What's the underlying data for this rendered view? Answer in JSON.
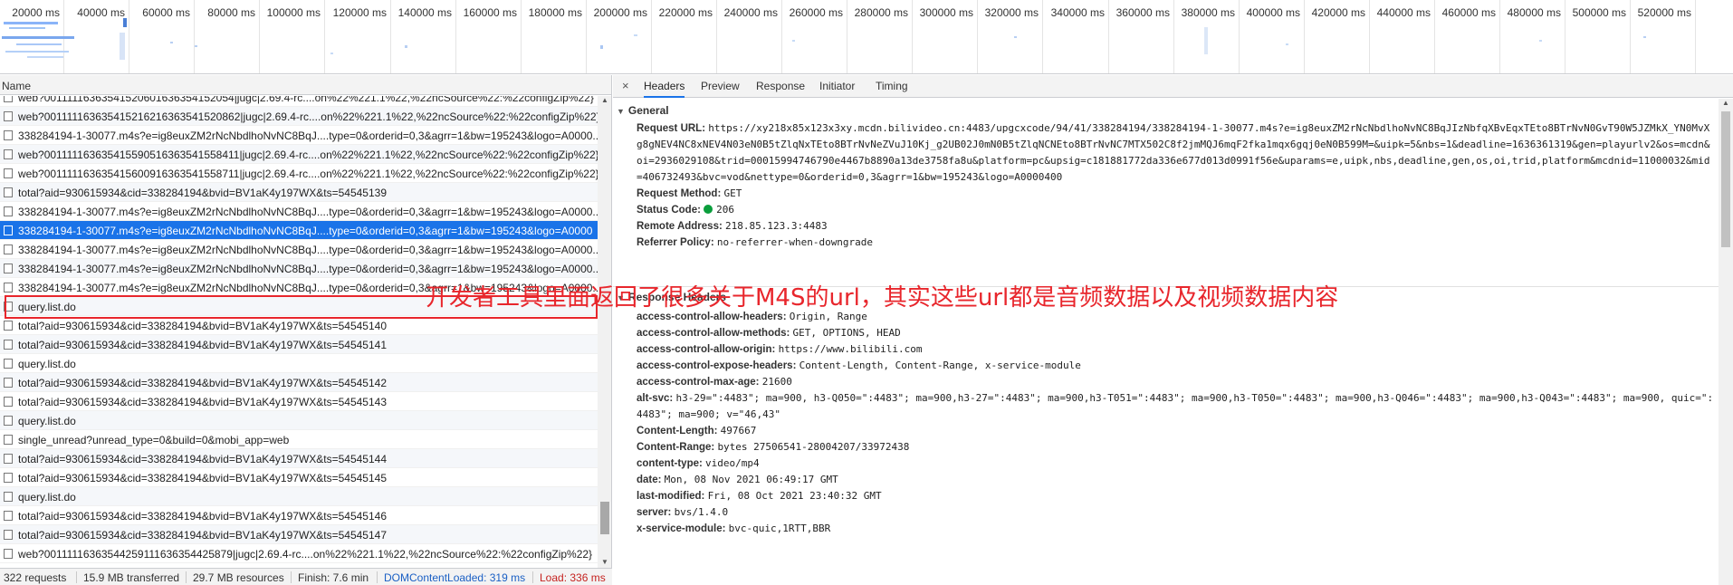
{
  "overview": {
    "ticks": [
      "20000 ms",
      "40000 ms",
      "60000 ms",
      "80000 ms",
      "100000 ms",
      "120000 ms",
      "140000 ms",
      "160000 ms",
      "180000 ms",
      "200000 ms",
      "220000 ms",
      "240000 ms",
      "260000 ms",
      "280000 ms",
      "300000 ms",
      "320000 ms",
      "340000 ms",
      "360000 ms",
      "380000 ms",
      "400000 ms",
      "420000 ms",
      "440000 ms",
      "460000 ms",
      "480000 ms",
      "500000 ms",
      "520000 ms"
    ]
  },
  "list": {
    "header": "Name",
    "rows": [
      "web?00111116363541520601636354152054|jugc|2.69.4-rc....on%22%221.1%22,%22ncSource%22:%22configZip%22}",
      "web?001111163635415216216363541520862|jugc|2.69.4-rc....on%22%221.1%22,%22ncSource%22:%22configZip%22}",
      "338284194-1-30077.m4s?e=ig8euxZM2rNcNbdlhoNvNC8BqJ....type=0&orderid=0,3&agrr=1&bw=195243&logo=A0000...",
      "web?001111163635415590516363541558411|jugc|2.69.4-rc....on%22%221.1%22,%22ncSource%22:%22configZip%22}",
      "web?001111163635415600916363541558711|jugc|2.69.4-rc....on%22%221.1%22,%22ncSource%22:%22configZip%22}",
      "total?aid=930615934&cid=338284194&bvid=BV1aK4y197WX&ts=54545139",
      "338284194-1-30077.m4s?e=ig8euxZM2rNcNbdlhoNvNC8BqJ....type=0&orderid=0,3&agrr=1&bw=195243&logo=A0000...",
      "338284194-1-30077.m4s?e=ig8euxZM2rNcNbdlhoNvNC8BqJ....type=0&orderid=0,3&agrr=1&bw=195243&logo=A0000",
      "338284194-1-30077.m4s?e=ig8euxZM2rNcNbdlhoNvNC8BqJ....type=0&orderid=0,3&agrr=1&bw=195243&logo=A0000...",
      "338284194-1-30077.m4s?e=ig8euxZM2rNcNbdlhoNvNC8BqJ....type=0&orderid=0,3&agrr=1&bw=195243&logo=A0000...",
      "338284194-1-30077.m4s?e=ig8euxZM2rNcNbdlhoNvNC8BqJ....type=0&orderid=0,3&agrr=1&bw=195243&logo=A0000...",
      "query.list.do",
      "total?aid=930615934&cid=338284194&bvid=BV1aK4y197WX&ts=54545140",
      "total?aid=930615934&cid=338284194&bvid=BV1aK4y197WX&ts=54545141",
      "query.list.do",
      "total?aid=930615934&cid=338284194&bvid=BV1aK4y197WX&ts=54545142",
      "total?aid=930615934&cid=338284194&bvid=BV1aK4y197WX&ts=54545143",
      "query.list.do",
      "single_unread?unread_type=0&build=0&mobi_app=web",
      "total?aid=930615934&cid=338284194&bvid=BV1aK4y197WX&ts=54545144",
      "total?aid=930615934&cid=338284194&bvid=BV1aK4y197WX&ts=54545145",
      "query.list.do",
      "total?aid=930615934&cid=338284194&bvid=BV1aK4y197WX&ts=54545146",
      "total?aid=930615934&cid=338284194&bvid=BV1aK4y197WX&ts=54545147",
      "web?00111116363544259111636354425879|jugc|2.69.4-rc....on%22%221.1%22,%22ncSource%22:%22configZip%22}"
    ],
    "selected_index": 7
  },
  "status": {
    "requests": "322 requests",
    "transferred": "15.9 MB transferred",
    "resources": "29.7 MB resources",
    "finish": "Finish: 7.6 min",
    "dom_loaded": "DOMContentLoaded: 319 ms",
    "load": "Load: 336 ms"
  },
  "tabs": {
    "close": "×",
    "items": [
      "Headers",
      "Preview",
      "Response",
      "Initiator",
      "Timing"
    ],
    "active": "Headers"
  },
  "general": {
    "title": "General",
    "request_url_key": "Request URL:",
    "request_url_value": "https://xy218x85x123x3xy.mcdn.bilivideo.cn:4483/upgcxcode/94/41/338284194/338284194-1-30077.m4s?e=ig8euxZM2rNcNbdlhoNvNC8BqJIzNbfqXBvEqxTEto8BTrNvN0GvT90W5JZMkX_YN0MvXg8gNEV4NC8xNEV4N03eN0B5tZlqNxTEto8BTrNvNeZVuJ10Kj_g2UB02J0mN0B5tZlqNCNEto8BTrNvNC7MTX502C8f2jmMQJ6mqF2fka1mqx6gqj0eN0B599M=&uipk=5&nbs=1&deadline=1636361319&gen=playurlv2&os=mcdn&oi=2936029108&trid=00015994746790e4467b8890a13de3758fa8u&platform=pc&upsig=c181881772da336e677d013d0991f56e&uparams=e,uipk,nbs,deadline,gen,os,oi,trid,platform&mcdnid=11000032&mid=406732493&bvc=vod&nettype=0&orderid=0,3&agrr=1&bw=195243&logo=A0000400",
    "method_key": "Request Method:",
    "method_value": "GET",
    "status_key": "Status Code:",
    "status_value": "206",
    "remote_key": "Remote Address:",
    "remote_value": "218.85.123.3:4483",
    "referrer_key": "Referrer Policy:",
    "referrer_value": "no-referrer-when-downgrade"
  },
  "response_headers": {
    "title": "Response Headers",
    "items": [
      {
        "k": "access-control-allow-headers:",
        "v": "Origin, Range"
      },
      {
        "k": "access-control-allow-methods:",
        "v": "GET, OPTIONS, HEAD"
      },
      {
        "k": "access-control-allow-origin:",
        "v": "https://www.bilibili.com"
      },
      {
        "k": "access-control-expose-headers:",
        "v": "Content-Length, Content-Range, x-service-module"
      },
      {
        "k": "access-control-max-age:",
        "v": "21600"
      },
      {
        "k": "alt-svc:",
        "v": "h3-29=\":4483\"; ma=900, h3-Q050=\":4483\"; ma=900,h3-27=\":4483\"; ma=900,h3-T051=\":4483\"; ma=900,h3-T050=\":4483\"; ma=900,h3-Q046=\":4483\"; ma=900,h3-Q043=\":4483\"; ma=900, quic=\":4483\"; ma=900; v=\"46,43\""
      },
      {
        "k": "Content-Length:",
        "v": "497667"
      },
      {
        "k": "Content-Range:",
        "v": "bytes 27506541-28004207/33972438"
      },
      {
        "k": "content-type:",
        "v": "video/mp4"
      },
      {
        "k": "date:",
        "v": "Mon, 08 Nov 2021 06:49:17 GMT"
      },
      {
        "k": "last-modified:",
        "v": "Fri, 08 Oct 2021 23:40:32 GMT"
      },
      {
        "k": "server:",
        "v": "bvs/1.4.0"
      },
      {
        "k": "x-service-module:",
        "v": "bvc-quic,1RTT,BBR"
      }
    ]
  },
  "annotation": "开发者工具里面返回了很多关于M4S的url，其实这些url都是音频数据以及视频数据内容",
  "colors": {
    "accent": "#1a73e8",
    "annotation": "#e8262c",
    "status_ok": "#0a9e3c"
  }
}
